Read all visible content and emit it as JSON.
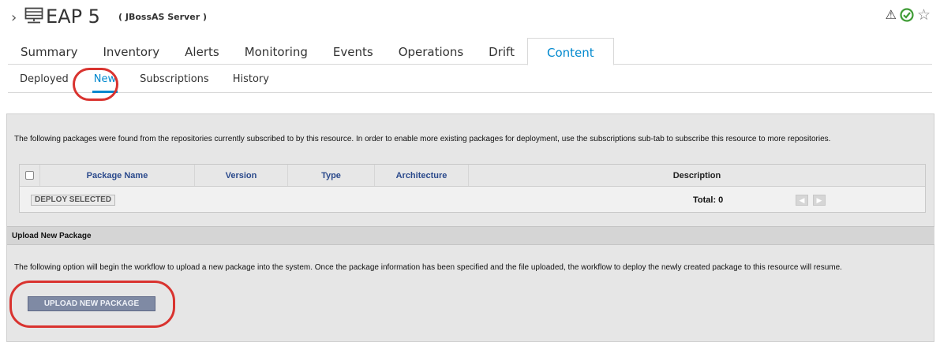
{
  "header": {
    "chevron": "›",
    "title": "EAP 5",
    "subtitle": "( JBossAS Server )",
    "icons": [
      "server-icon",
      "warning-icon",
      "check-circle-icon",
      "star-icon"
    ]
  },
  "main_tabs": [
    {
      "label": "Summary"
    },
    {
      "label": "Inventory"
    },
    {
      "label": "Alerts"
    },
    {
      "label": "Monitoring"
    },
    {
      "label": "Events"
    },
    {
      "label": "Operations"
    },
    {
      "label": "Drift"
    },
    {
      "label": "Content",
      "active": true
    }
  ],
  "sub_tabs": [
    {
      "label": "Deployed"
    },
    {
      "label": "New",
      "active": true
    },
    {
      "label": "Subscriptions"
    },
    {
      "label": "History"
    }
  ],
  "content": {
    "intro": "The following packages were found from the repositories currently subscribed to by this resource. In order to enable more existing packages for deployment, use the subscriptions sub-tab to subscribe this resource to more repositories.",
    "table": {
      "columns": [
        "Package Name",
        "Version",
        "Type",
        "Architecture",
        "Description"
      ],
      "rows": [],
      "deploy_label": "DEPLOY SELECTED",
      "total_label": "Total: 0"
    },
    "upload": {
      "section_title": "Upload New Package",
      "text": "The following option will begin the workflow to upload a new package into the system. Once the package information has been specified and the file uploaded, the workflow to deploy the newly created package to this resource will resume.",
      "button_label": "UPLOAD NEW PACKAGE"
    }
  },
  "colors": {
    "active_tab": "#0088ce",
    "annotation": "#d9332f",
    "ok": "#3f9c35"
  }
}
